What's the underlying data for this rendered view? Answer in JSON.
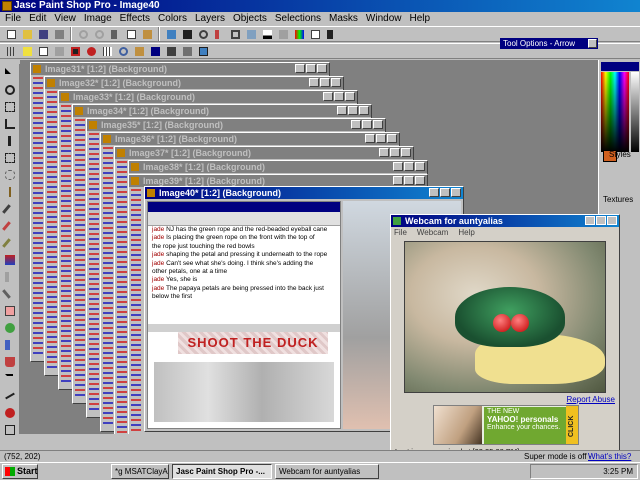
{
  "app": {
    "title": "Jasc Paint Shop Pro - Image40",
    "menu": [
      "File",
      "Edit",
      "View",
      "Image",
      "Effects",
      "Colors",
      "Layers",
      "Objects",
      "Selections",
      "Masks",
      "Window",
      "Help"
    ],
    "tool_options_title": "Tool Options - Arrow",
    "status_coords": "(752, 202)"
  },
  "documents": [
    {
      "title": "Image31* [1:2] (Background)"
    },
    {
      "title": "Image32* [1:2] (Background)"
    },
    {
      "title": "Image33* [1:2] (Background)"
    },
    {
      "title": "Image34* [1:2] (Background)"
    },
    {
      "title": "Image35* [1:2] (Background)"
    },
    {
      "title": "Image36* [1:2] (Background)"
    },
    {
      "title": "Image37* [1:2] (Background)"
    },
    {
      "title": "Image38* [1:2] (Background)"
    },
    {
      "title": "Image39* [1:2] (Background)"
    },
    {
      "title": "Image40* [1:2] (Background)"
    }
  ],
  "chat": {
    "lines": [
      {
        "who": "jade",
        "text": "NJ has the green rope and the red-beaded eyeball cane"
      },
      {
        "who": "jade",
        "text": "Is placing the green rope on the front with the top of"
      },
      {
        "who": "",
        "text": "the rope just touching the red bowls"
      },
      {
        "who": "jade",
        "text": "shaping the petal and pressing it underneath to the rope"
      },
      {
        "who": "jade",
        "text": "Can't see what she's doing. I think she's adding the"
      },
      {
        "who": "",
        "text": "other petals, one at a time"
      },
      {
        "who": "jade",
        "text": "Yes, she is"
      },
      {
        "who": "jade",
        "text": "The papaya petals are being pressed into the back just"
      },
      {
        "who": "",
        "text": "below the first"
      }
    ],
    "banner": "SHOOT THE DUCK"
  },
  "palette": {
    "styles_label": "Styles",
    "textures_label": "Textures"
  },
  "webcam": {
    "title": "Webcam for auntyalias",
    "menu": [
      "File",
      "Webcam",
      "Help"
    ],
    "report_abuse": "Report Abuse",
    "ad_line1": "THE NEW",
    "ad_line2": "YAHOO! personals",
    "ad_line3": "Enhance your chances.",
    "ad_click": "CLICK",
    "last_image": "Last image received at [03:25:08 PM]",
    "super_mode": "Super mode is off -",
    "whats_this": "What's this?"
  },
  "taskbar": {
    "start": "Start",
    "tasks": [
      {
        "label": "*g MSATClayArt:1 -- Chat",
        "active": false
      },
      {
        "label": "Jasc Paint Shop Pro -...",
        "active": true
      },
      {
        "label": "Webcam for auntyalias",
        "active": false
      }
    ],
    "clock": "3:25 PM"
  },
  "colors": {
    "titlebar": "#000080",
    "desktop": "#008080"
  }
}
